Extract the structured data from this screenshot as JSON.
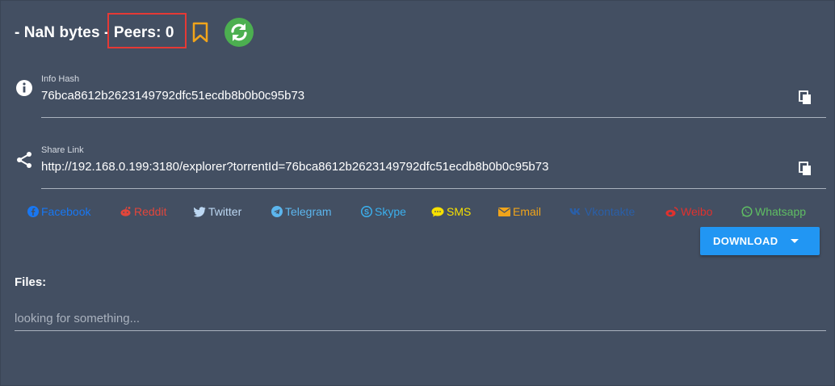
{
  "header": {
    "size_text": "- NaN bytes - ",
    "peers_text": "Peers: 0"
  },
  "info_hash": {
    "label": "Info Hash",
    "value": "76bca8612b2623149792dfc51ecdb8b0b0c95b73"
  },
  "share_link": {
    "label": "Share Link",
    "value": "http://192.168.0.199:3180/explorer?torrentId=76bca8612b2623149792dfc51ecdb8b0b0c95b73"
  },
  "shares": [
    {
      "label": "Facebook",
      "icon": "facebook-icon",
      "color": "#1877f2"
    },
    {
      "label": "Reddit",
      "icon": "reddit-icon",
      "color": "#e2463b"
    },
    {
      "label": "Twitter",
      "icon": "twitter-icon",
      "color": "#bcd7f2"
    },
    {
      "label": "Telegram",
      "icon": "telegram-icon",
      "color": "#5cb6ee"
    },
    {
      "label": "Skype",
      "icon": "skype-icon",
      "color": "#3bb0ee"
    },
    {
      "label": "SMS",
      "icon": "sms-icon",
      "color": "#f6e000"
    },
    {
      "label": "Email",
      "icon": "email-icon",
      "color": "#f0a41b"
    },
    {
      "label": "Vkontakte",
      "icon": "vk-icon",
      "color": "#2a5fa8"
    },
    {
      "label": "Weibo",
      "icon": "weibo-icon",
      "color": "#e0312e"
    },
    {
      "label": "Whatsapp",
      "icon": "whatsapp-icon",
      "color": "#5fbe63"
    }
  ],
  "download": {
    "label": "DOWNLOAD"
  },
  "files": {
    "label": "Files:",
    "search_placeholder": "looking for something..."
  },
  "colors": {
    "background": "#434f62",
    "highlight_box": "#e53935",
    "bookmark": "#f0a41b",
    "refresh": "#4caf50",
    "download": "#2196f3"
  }
}
